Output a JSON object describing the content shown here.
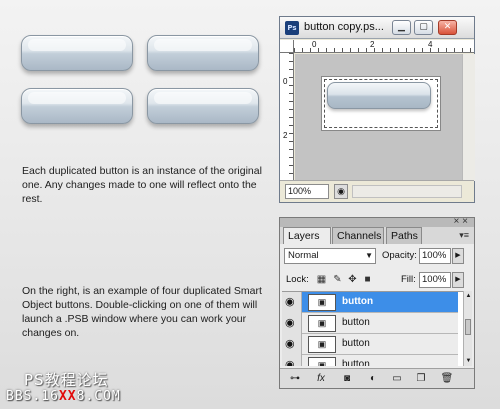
{
  "preview_buttons": [
    "",
    "",
    "",
    ""
  ],
  "captions": {
    "first": "Each duplicated button is an instance of the original one. Any changes made to one will reflect onto the rest.",
    "second": "On the right, is an example of four duplicated Smart Object buttons. Double-clicking on one of them will launch a .PSB window where you can work your changes on."
  },
  "document_window": {
    "title": "button copy.ps...",
    "app_badge": "Ps",
    "ruler_top_labels": [
      "0",
      "2",
      "4"
    ],
    "ruler_left_labels": [
      "0",
      "2"
    ],
    "zoom": "100%",
    "icons": {
      "minimize": "minimize-icon",
      "maximize": "maximize-icon",
      "close": "close-icon"
    }
  },
  "layers_panel": {
    "tabs": [
      "Layers",
      "Channels",
      "Paths"
    ],
    "active_tab": "Layers",
    "blend_mode": "Normal",
    "opacity_label": "Opacity:",
    "opacity_value": "100%",
    "lock_label": "Lock:",
    "fill_label": "Fill:",
    "fill_value": "100%",
    "layers": [
      {
        "name": "button",
        "selected": true
      },
      {
        "name": "button",
        "selected": false
      },
      {
        "name": "button",
        "selected": false
      },
      {
        "name": "button",
        "selected": false
      }
    ],
    "footer_icons": [
      "link-icon",
      "fx-icon",
      "mask-icon",
      "adjustment-icon",
      "group-icon",
      "new-layer-icon",
      "trash-icon"
    ]
  },
  "watermark": {
    "line1": "PS教程论坛",
    "line2_prefix": "BBS.16",
    "line2_highlight": "XX",
    "line2_suffix": "8.COM"
  }
}
